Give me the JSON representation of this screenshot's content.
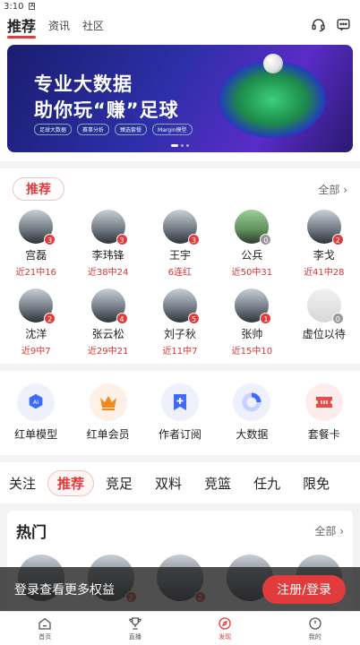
{
  "status": {
    "time": "3:10"
  },
  "topnav": {
    "tabs": [
      {
        "label": "推荐",
        "active": true
      },
      {
        "label": "资讯",
        "active": false
      },
      {
        "label": "社区",
        "active": false
      }
    ]
  },
  "banner": {
    "line1": "专业大数据",
    "line2": "助你玩“赚”足球",
    "chips": [
      "足球大数据",
      "赛事分析",
      "臻选套餐",
      "Margin模型"
    ]
  },
  "experts": {
    "section_label": "推荐",
    "all_label": "全部",
    "items": [
      {
        "name": "宫磊",
        "record": "近21中16",
        "badge": "3"
      },
      {
        "name": "李玮锋",
        "record": "近38中24",
        "badge": "3"
      },
      {
        "name": "王宇",
        "record": "6连红",
        "badge": "3"
      },
      {
        "name": "公兵",
        "record": "近50中31",
        "badge": "0"
      },
      {
        "name": "李戈",
        "record": "近41中28",
        "badge": "2"
      },
      {
        "name": "沈洋",
        "record": "近9中7",
        "badge": "2"
      },
      {
        "name": "张云松",
        "record": "近29中21",
        "badge": "4"
      },
      {
        "name": "刘子秋",
        "record": "近11中7",
        "badge": "5"
      },
      {
        "name": "张帅",
        "record": "近15中10",
        "badge": "1"
      },
      {
        "name": "虚位以待",
        "record": "",
        "badge": "0"
      }
    ]
  },
  "features": [
    {
      "label": "红单模型",
      "icon": "ai-icon"
    },
    {
      "label": "红单会员",
      "icon": "crown-icon"
    },
    {
      "label": "作者订阅",
      "icon": "bookmark-plus-icon"
    },
    {
      "label": "大数据",
      "icon": "ring-chart-icon"
    },
    {
      "label": "套餐卡",
      "icon": "ticket-icon"
    }
  ],
  "categories": [
    {
      "label": "关注",
      "active": false
    },
    {
      "label": "推荐",
      "active": true
    },
    {
      "label": "竞足",
      "active": false
    },
    {
      "label": "双料",
      "active": false
    },
    {
      "label": "竞篮",
      "active": false
    },
    {
      "label": "任九",
      "active": false
    },
    {
      "label": "限免",
      "active": false
    }
  ],
  "hot": {
    "title": "热门",
    "all_label": "全部",
    "badges": [
      "",
      "2",
      "2",
      "",
      ""
    ]
  },
  "login_bar": {
    "text": "登录查看更多权益",
    "button": "注册/登录"
  },
  "bottom_nav": [
    {
      "label": "首页",
      "icon": "home-icon",
      "active": false
    },
    {
      "label": "直播",
      "icon": "trophy-icon",
      "active": false
    },
    {
      "label": "发现",
      "icon": "compass-icon",
      "active": true
    },
    {
      "label": "我的",
      "icon": "user-icon",
      "active": false
    }
  ],
  "colors": {
    "accent": "#e23b3b",
    "banner": "#2c2fa8"
  }
}
